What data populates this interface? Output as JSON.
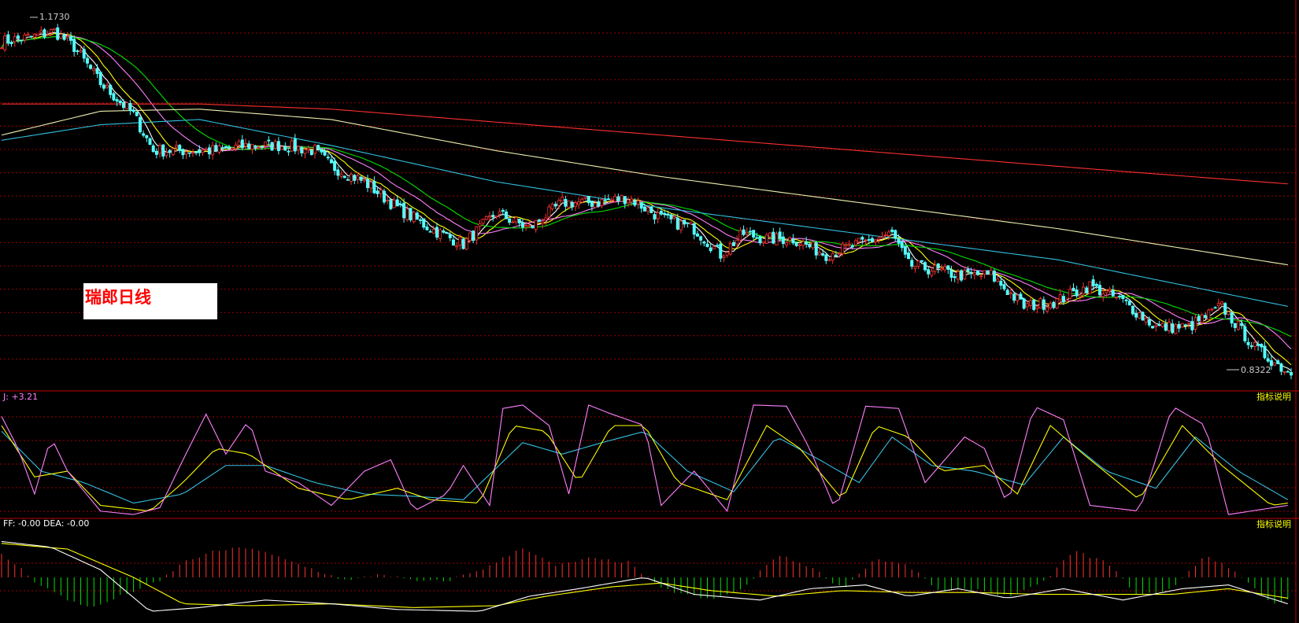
{
  "title": "瑞郎日线",
  "price_panel": {
    "high_label": "1.1730",
    "low_label": "0.8322"
  },
  "kdj_panel": {
    "readout": "J: +3.21",
    "link": "指标说明"
  },
  "macd_panel": {
    "readout": "FF: -0.00 DEA: -0.00",
    "link": "指标说明"
  },
  "colors": {
    "up": "#ff3333",
    "down": "#54ffff",
    "ma5": "#ffffff",
    "ma10": "#ffff00",
    "ma20": "#ff80ff",
    "ma30": "#00e000",
    "ma60": "#33c0e0",
    "ma120": "#f0f0b0",
    "ma250": "#ff3030",
    "grid": "#a00000",
    "k": "#ffffff",
    "d": "#ffff00",
    "j": "#ff80ff"
  },
  "chart_data": [
    {
      "type": "line",
      "panel": "price",
      "note_series": "candlestick trend approximated by control points (bar index, price)",
      "ylim": [
        0.82,
        1.18
      ],
      "bars": 260,
      "price_path": [
        [
          0,
          1.155
        ],
        [
          10,
          1.16
        ],
        [
          16,
          1.165
        ],
        [
          22,
          1.15
        ],
        [
          30,
          1.115
        ],
        [
          40,
          1.085
        ],
        [
          46,
          1.05
        ],
        [
          55,
          1.05
        ],
        [
          65,
          1.05
        ],
        [
          75,
          1.055
        ],
        [
          85,
          1.055
        ],
        [
          95,
          1.05
        ],
        [
          100,
          1.035
        ],
        [
          110,
          1.02
        ],
        [
          120,
          0.995
        ],
        [
          130,
          0.975
        ],
        [
          140,
          0.96
        ],
        [
          150,
          0.99
        ],
        [
          160,
          0.975
        ],
        [
          170,
          1.0
        ],
        [
          180,
          1.0
        ],
        [
          190,
          1.005
        ],
        [
          200,
          0.985
        ],
        [
          210,
          0.975
        ],
        [
          218,
          0.95
        ],
        [
          225,
          0.97
        ],
        [
          232,
          0.965
        ],
        [
          240,
          0.965
        ],
        [
          250,
          0.95
        ],
        [
          260,
          0.96
        ],
        [
          270,
          0.97
        ],
        [
          275,
          0.94
        ],
        [
          283,
          0.935
        ],
        [
          290,
          0.93
        ],
        [
          300,
          0.93
        ],
        [
          310,
          0.9
        ],
        [
          320,
          0.905
        ],
        [
          330,
          0.92
        ],
        [
          340,
          0.905
        ],
        [
          350,
          0.88
        ],
        [
          360,
          0.88
        ],
        [
          370,
          0.9
        ],
        [
          380,
          0.86
        ],
        [
          390,
          0.837
        ]
      ],
      "moving_averages": [
        {
          "period": 5,
          "color_key": "ma5"
        },
        {
          "period": 10,
          "color_key": "ma10"
        },
        {
          "period": 20,
          "color_key": "ma20"
        },
        {
          "period": 30,
          "color_key": "ma30"
        },
        {
          "period": 60,
          "path": [
            [
              0,
              1.06
            ],
            [
              30,
              1.075
            ],
            [
              60,
              1.08
            ],
            [
              100,
              1.055
            ],
            [
              150,
              1.02
            ],
            [
              200,
              0.995
            ],
            [
              260,
              0.97
            ],
            [
              320,
              0.945
            ],
            [
              390,
              0.9
            ]
          ]
        },
        {
          "period": 120,
          "path": [
            [
              0,
              1.065
            ],
            [
              30,
              1.088
            ],
            [
              60,
              1.09
            ],
            [
              100,
              1.08
            ],
            [
              150,
              1.05
            ],
            [
              200,
              1.025
            ],
            [
              260,
              1.0
            ],
            [
              320,
              0.975
            ],
            [
              390,
              0.94
            ]
          ]
        },
        {
          "period": 250,
          "path": [
            [
              0,
              1.095
            ],
            [
              60,
              1.095
            ],
            [
              100,
              1.09
            ],
            [
              160,
              1.075
            ],
            [
              220,
              1.06
            ],
            [
              280,
              1.045
            ],
            [
              340,
              1.03
            ],
            [
              390,
              1.018
            ]
          ]
        }
      ]
    },
    {
      "type": "line",
      "panel": "kdj",
      "ylim": [
        0,
        100
      ],
      "j_path": [
        [
          0,
          88
        ],
        [
          5,
          60
        ],
        [
          10,
          20
        ],
        [
          15,
          70
        ],
        [
          20,
          40
        ],
        [
          30,
          5
        ],
        [
          40,
          2
        ],
        [
          48,
          8
        ],
        [
          55,
          50
        ],
        [
          62,
          90
        ],
        [
          68,
          55
        ],
        [
          75,
          85
        ],
        [
          80,
          40
        ],
        [
          90,
          30
        ],
        [
          100,
          10
        ],
        [
          110,
          40
        ],
        [
          118,
          50
        ],
        [
          125,
          5
        ],
        [
          135,
          20
        ],
        [
          140,
          45
        ],
        [
          148,
          10
        ],
        [
          152,
          95
        ],
        [
          158,
          98
        ],
        [
          166,
          80
        ],
        [
          172,
          20
        ],
        [
          178,
          98
        ],
        [
          185,
          90
        ],
        [
          195,
          80
        ],
        [
          200,
          10
        ],
        [
          210,
          40
        ],
        [
          220,
          5
        ],
        [
          228,
          98
        ],
        [
          238,
          97
        ],
        [
          245,
          60
        ],
        [
          253,
          5
        ],
        [
          262,
          97
        ],
        [
          272,
          95
        ],
        [
          280,
          30
        ],
        [
          292,
          70
        ],
        [
          298,
          60
        ],
        [
          305,
          10
        ],
        [
          313,
          97
        ],
        [
          322,
          85
        ],
        [
          330,
          10
        ],
        [
          345,
          5
        ],
        [
          355,
          97
        ],
        [
          365,
          80
        ],
        [
          372,
          2
        ],
        [
          390,
          10
        ]
      ],
      "k_path": [
        [
          0,
          80
        ],
        [
          10,
          35
        ],
        [
          20,
          40
        ],
        [
          30,
          10
        ],
        [
          45,
          5
        ],
        [
          55,
          30
        ],
        [
          65,
          60
        ],
        [
          75,
          55
        ],
        [
          90,
          25
        ],
        [
          105,
          15
        ],
        [
          120,
          25
        ],
        [
          130,
          15
        ],
        [
          145,
          12
        ],
        [
          155,
          80
        ],
        [
          165,
          75
        ],
        [
          175,
          30
        ],
        [
          185,
          80
        ],
        [
          195,
          80
        ],
        [
          205,
          30
        ],
        [
          220,
          15
        ],
        [
          232,
          80
        ],
        [
          242,
          60
        ],
        [
          255,
          15
        ],
        [
          265,
          80
        ],
        [
          275,
          70
        ],
        [
          285,
          40
        ],
        [
          298,
          45
        ],
        [
          308,
          20
        ],
        [
          318,
          80
        ],
        [
          328,
          55
        ],
        [
          345,
          15
        ],
        [
          358,
          80
        ],
        [
          370,
          45
        ],
        [
          385,
          10
        ],
        [
          390,
          12
        ]
      ],
      "d_path": [
        [
          0,
          75
        ],
        [
          12,
          40
        ],
        [
          25,
          30
        ],
        [
          40,
          12
        ],
        [
          55,
          20
        ],
        [
          68,
          45
        ],
        [
          80,
          45
        ],
        [
          95,
          30
        ],
        [
          110,
          20
        ],
        [
          125,
          18
        ],
        [
          140,
          15
        ],
        [
          158,
          65
        ],
        [
          170,
          55
        ],
        [
          182,
          65
        ],
        [
          195,
          75
        ],
        [
          208,
          40
        ],
        [
          222,
          22
        ],
        [
          235,
          70
        ],
        [
          248,
          50
        ],
        [
          260,
          30
        ],
        [
          270,
          70
        ],
        [
          282,
          45
        ],
        [
          295,
          40
        ],
        [
          310,
          28
        ],
        [
          322,
          70
        ],
        [
          335,
          40
        ],
        [
          350,
          25
        ],
        [
          362,
          70
        ],
        [
          375,
          40
        ],
        [
          390,
          15
        ]
      ]
    },
    {
      "type": "bar",
      "panel": "macd",
      "ylim": [
        -1,
        1
      ],
      "histogram_path": [
        [
          0,
          0.6
        ],
        [
          5,
          0.3
        ],
        [
          10,
          -0.1
        ],
        [
          20,
          -0.6
        ],
        [
          28,
          -0.8
        ],
        [
          36,
          -0.5
        ],
        [
          48,
          -0.1
        ],
        [
          55,
          0.4
        ],
        [
          65,
          0.7
        ],
        [
          75,
          0.8
        ],
        [
          85,
          0.5
        ],
        [
          95,
          0.2
        ],
        [
          105,
          -0.1
        ],
        [
          115,
          0.1
        ],
        [
          125,
          -0.1
        ],
        [
          135,
          -0.1
        ],
        [
          148,
          0.3
        ],
        [
          158,
          0.8
        ],
        [
          168,
          0.3
        ],
        [
          178,
          0.5
        ],
        [
          190,
          0.4
        ],
        [
          200,
          -0.3
        ],
        [
          215,
          -0.6
        ],
        [
          225,
          -0.3
        ],
        [
          235,
          0.6
        ],
        [
          245,
          0.3
        ],
        [
          255,
          -0.3
        ],
        [
          265,
          0.5
        ],
        [
          275,
          0.3
        ],
        [
          285,
          -0.4
        ],
        [
          295,
          -0.3
        ],
        [
          305,
          -0.5
        ],
        [
          315,
          -0.2
        ],
        [
          325,
          0.7
        ],
        [
          335,
          0.4
        ],
        [
          345,
          -0.5
        ],
        [
          355,
          -0.3
        ],
        [
          365,
          0.6
        ],
        [
          375,
          0.1
        ],
        [
          385,
          -0.7
        ],
        [
          390,
          -0.6
        ]
      ],
      "dif_path": [
        [
          0,
          0.95
        ],
        [
          15,
          0.8
        ],
        [
          30,
          0.2
        ],
        [
          45,
          -0.9
        ],
        [
          60,
          -0.8
        ],
        [
          80,
          -0.6
        ],
        [
          100,
          -0.7
        ],
        [
          120,
          -0.85
        ],
        [
          145,
          -0.9
        ],
        [
          160,
          -0.5
        ],
        [
          175,
          -0.3
        ],
        [
          195,
          0.0
        ],
        [
          210,
          -0.45
        ],
        [
          230,
          -0.6
        ],
        [
          245,
          -0.3
        ],
        [
          262,
          -0.2
        ],
        [
          275,
          -0.5
        ],
        [
          290,
          -0.3
        ],
        [
          305,
          -0.55
        ],
        [
          322,
          -0.3
        ],
        [
          340,
          -0.6
        ],
        [
          358,
          -0.3
        ],
        [
          372,
          -0.2
        ],
        [
          390,
          -0.7
        ]
      ],
      "dea_path": [
        [
          0,
          0.9
        ],
        [
          20,
          0.75
        ],
        [
          40,
          0.0
        ],
        [
          55,
          -0.7
        ],
        [
          75,
          -0.75
        ],
        [
          100,
          -0.7
        ],
        [
          125,
          -0.8
        ],
        [
          150,
          -0.75
        ],
        [
          165,
          -0.5
        ],
        [
          185,
          -0.25
        ],
        [
          200,
          -0.15
        ],
        [
          215,
          -0.35
        ],
        [
          235,
          -0.5
        ],
        [
          255,
          -0.35
        ],
        [
          275,
          -0.4
        ],
        [
          295,
          -0.4
        ],
        [
          315,
          -0.45
        ],
        [
          335,
          -0.45
        ],
        [
          355,
          -0.45
        ],
        [
          372,
          -0.3
        ],
        [
          390,
          -0.55
        ]
      ]
    }
  ]
}
